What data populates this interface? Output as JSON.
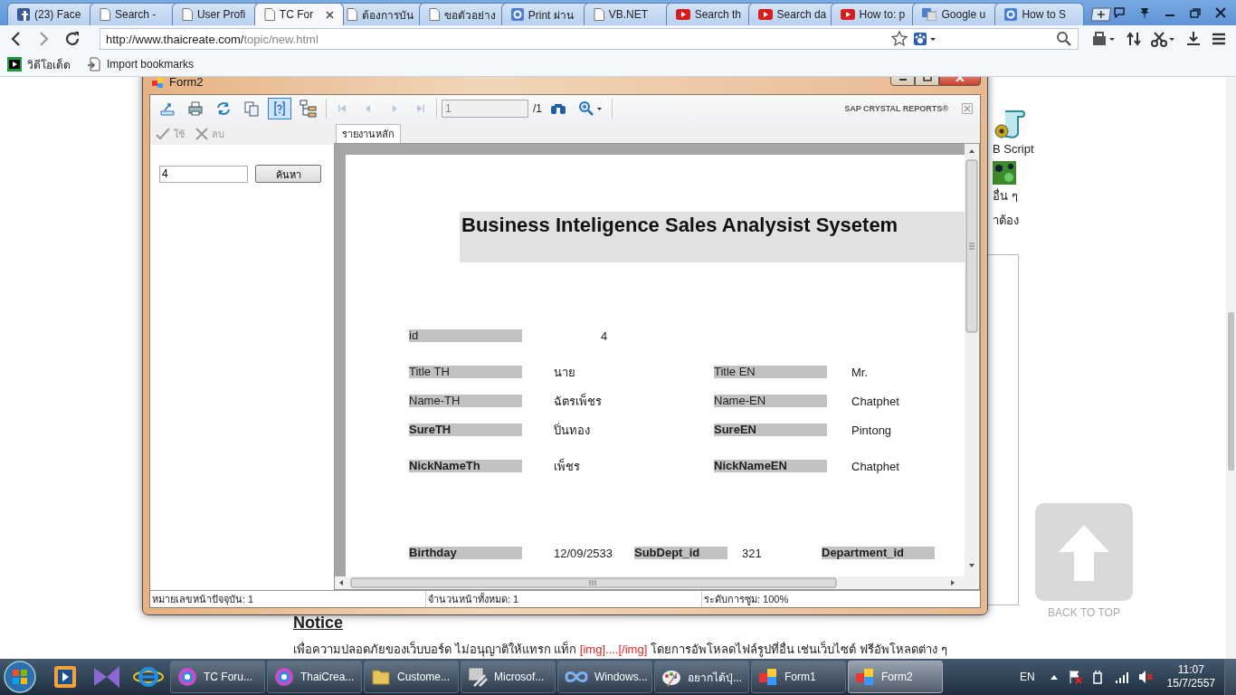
{
  "browser": {
    "tabs": [
      {
        "title": "(23) Face",
        "kind": "social",
        "selected": false
      },
      {
        "title": "Search -",
        "kind": "page",
        "selected": false
      },
      {
        "title": "User Profi",
        "kind": "page",
        "selected": false
      },
      {
        "title": "TC For",
        "kind": "page",
        "selected": true
      },
      {
        "title": "ต้องการบัน",
        "kind": "page",
        "selected": false
      },
      {
        "title": "ขอตัวอย่าง",
        "kind": "page",
        "selected": false
      },
      {
        "title": "Print ผ่าน",
        "kind": "square",
        "selected": false
      },
      {
        "title": "VB.NET",
        "kind": "page",
        "selected": false
      },
      {
        "title": "Search th",
        "kind": "play",
        "selected": false
      },
      {
        "title": "Search da",
        "kind": "play",
        "selected": false
      },
      {
        "title": "How to: p",
        "kind": "play",
        "selected": false
      },
      {
        "title": "Google u",
        "kind": "translate",
        "selected": false
      },
      {
        "title": "How to S",
        "kind": "square",
        "selected": false
      }
    ],
    "address": {
      "host": "http://www.thaicreate.com/",
      "path": "topic/new.html"
    },
    "bookmarks": [
      {
        "label": "วิดีโอเด็ด",
        "kind": "video"
      },
      {
        "label": "Import bookmarks",
        "kind": "import"
      }
    ]
  },
  "page": {
    "side_items": [
      {
        "label": "B Script",
        "kind": "script"
      },
      {
        "label": "อื่น ๆ",
        "kind": "tile"
      },
      {
        "label": "าต้อง",
        "kind": "text"
      }
    ],
    "back_to_top": "BACK TO TOP",
    "notice": {
      "heading": "Notice",
      "parts": [
        {
          "text": "เพื่อความปลอดภัยของเว็บบอร์ด ไม่อนุญาติให้แทรก แท็ก ",
          "kind": "plain"
        },
        {
          "text": "[img]....[/img]",
          "kind": "tag"
        },
        {
          "text": " โดยการอัพโหลดไฟล์รูปที่อื่น เช่นเว็บไซต์ ฟรีอัพโหลดต่าง ๆ",
          "kind": "plain"
        }
      ]
    }
  },
  "form": {
    "title": "Form2",
    "tools": [
      {
        "kind": "export",
        "pressed": false,
        "disabled": false
      },
      {
        "kind": "print",
        "pressed": false,
        "disabled": false
      },
      {
        "kind": "refresh",
        "pressed": false,
        "disabled": false
      },
      {
        "kind": "copy",
        "pressed": false,
        "disabled": false
      },
      {
        "kind": "help",
        "pressed": true,
        "disabled": false
      },
      {
        "kind": "tree",
        "pressed": false,
        "disabled": false
      },
      {
        "kind": "first",
        "pressed": false,
        "disabled": true
      },
      {
        "kind": "prev",
        "pressed": false,
        "disabled": true
      },
      {
        "kind": "next",
        "pressed": false,
        "disabled": true
      },
      {
        "kind": "last",
        "pressed": false,
        "disabled": true
      }
    ],
    "page_field": "1",
    "page_total": "/1",
    "brand": "SAP CRYSTAL REPORTS®",
    "actions": [
      {
        "label": "ใช้",
        "kind": "check",
        "disabled": true
      },
      {
        "label": "ลบ",
        "kind": "delete",
        "disabled": true
      }
    ],
    "search": {
      "value": "4",
      "button": "ค้นหา"
    },
    "view_tabs": [
      {
        "label": "รายงานหลัก",
        "selected": true
      }
    ],
    "report": {
      "title": "Business Inteligence Sales Analysist Sysetem",
      "rows": [
        {
          "kind": "single",
          "fields": [
            {
              "label": "id",
              "value": "4",
              "bold": false
            }
          ]
        },
        {
          "kind": "pair",
          "fields": [
            {
              "label": "Title TH",
              "value": "นาย",
              "bold": false
            },
            {
              "label": "Title EN",
              "value": "Mr.",
              "bold": false
            }
          ]
        },
        {
          "kind": "pair",
          "fields": [
            {
              "label": "Name-TH",
              "value": "ฉัตรเพ็ชร",
              "bold": false
            },
            {
              "label": "Name-EN",
              "value": "Chatphet",
              "bold": false
            }
          ]
        },
        {
          "kind": "pair",
          "fields": [
            {
              "label": "SureTH",
              "value": "ปิ่นทอง",
              "bold": true
            },
            {
              "label": "SureEN",
              "value": "Pintong",
              "bold": true
            }
          ]
        },
        {
          "kind": "pair",
          "fields": [
            {
              "label": "NickNameTh",
              "value": "เพ็ชร",
              "bold": true
            },
            {
              "label": "NickNameEN",
              "value": "Chatphet",
              "bold": true
            }
          ]
        },
        {
          "kind": "triple",
          "fields": [
            {
              "label": "Birthday",
              "value": "12/09/2533",
              "bold": true
            },
            {
              "label": "SubDept_id",
              "value": "321",
              "bold": true
            },
            {
              "label": "Department_id",
              "bold": true
            }
          ]
        }
      ]
    },
    "status": [
      "หมายเลขหน้าปัจจุบัน: 1",
      "จำนวนหน้าทั้งหมด: 1",
      "ระดับการซูม: 100%"
    ]
  },
  "taskbar": {
    "tasks": [
      {
        "label": "TC Foru...",
        "kind": "browser",
        "selected": false
      },
      {
        "label": "ThaiCrea...",
        "kind": "browser",
        "selected": false
      },
      {
        "label": "Custome...",
        "kind": "folder",
        "selected": false
      },
      {
        "label": "Microsof...",
        "kind": "tools",
        "selected": false
      },
      {
        "label": "Windows...",
        "kind": "infinity",
        "selected": false
      },
      {
        "label": "อยากได้ปุ่...",
        "kind": "paint",
        "selected": false
      },
      {
        "label": "Form1",
        "kind": "form",
        "selected": false
      },
      {
        "label": "Form2",
        "kind": "form",
        "selected": true
      }
    ],
    "language": "EN",
    "time": "11:07",
    "date": "15/7/2557"
  }
}
